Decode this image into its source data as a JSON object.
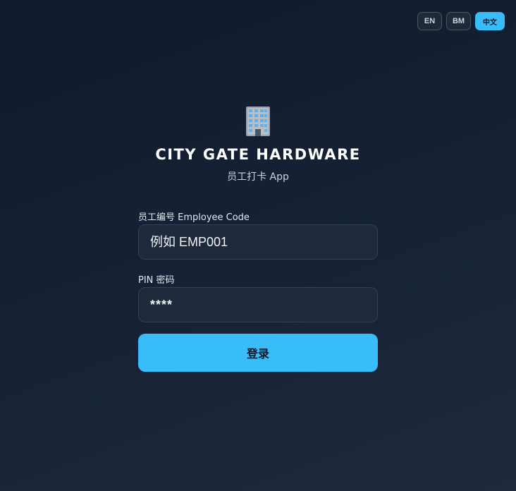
{
  "languages": [
    {
      "code": "EN",
      "label": "EN",
      "active": false
    },
    {
      "code": "BM",
      "label": "BM",
      "active": false
    },
    {
      "code": "ZH",
      "label": "中文",
      "active": true
    }
  ],
  "brand": {
    "icon": "office-building-icon",
    "title": "CITY GATE HARDWARE",
    "subtitle": "员工打卡 App"
  },
  "form": {
    "employee_code": {
      "label": "员工编号 Employee Code",
      "placeholder": "例如 EMP001",
      "value": ""
    },
    "pin": {
      "label": "PIN 密码",
      "placeholder": "****",
      "value": ""
    },
    "submit_label": "登录"
  },
  "colors": {
    "accent": "#38bdf8",
    "background": "#172236",
    "input_bg": "#1e293b"
  }
}
